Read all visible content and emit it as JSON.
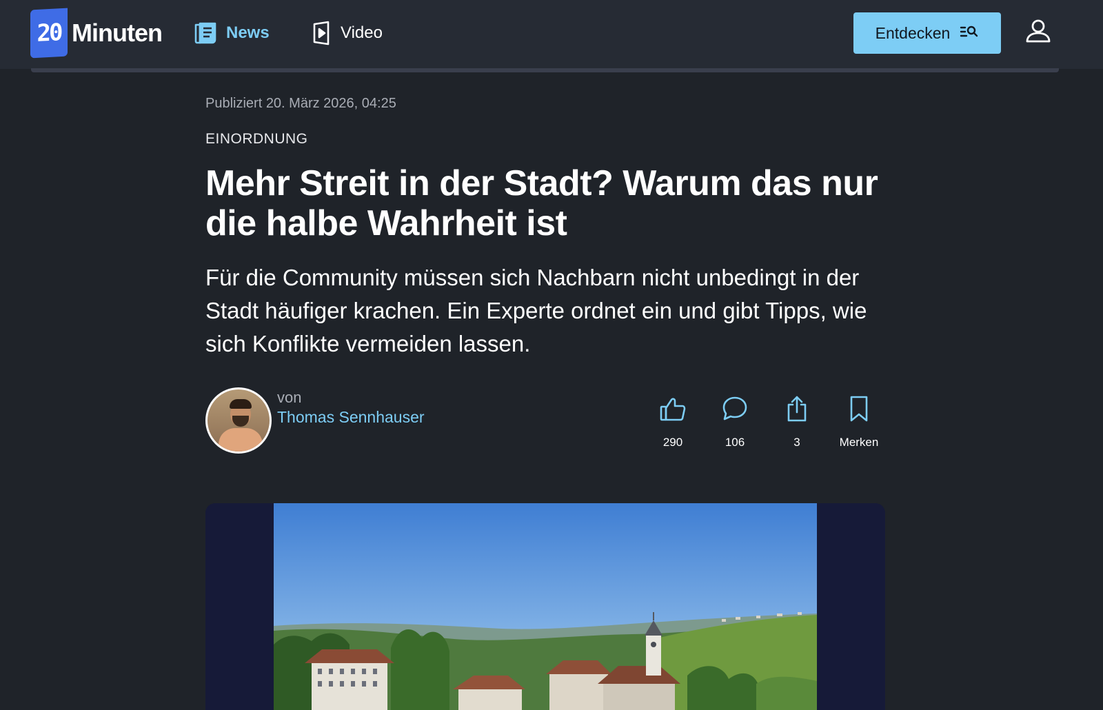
{
  "header": {
    "logo_mark": "20",
    "logo_text": "Minuten",
    "nav": {
      "news": "News",
      "video": "Video"
    },
    "discover_label": "Entdecken"
  },
  "colors": {
    "background": "#1f2329",
    "header_background": "#262b34",
    "accent": "#7dcdf5",
    "logo_blue": "#3f6ce6",
    "hero_background": "#161a38"
  },
  "article": {
    "published": "Publiziert 20. März 2026, 04:25",
    "category": "EINORDNUNG",
    "headline": "Mehr Streit in der Stadt? Warum das nur die halbe Wahrheit ist",
    "lead": "Für die Community müssen sich Nachbarn nicht unbedingt in der Stadt häufiger krachen. Ein Experte ordnet ein und gibt Tipps, wie sich Konflikte vermeiden lassen.",
    "author_prefix": "von",
    "author_name": "Thomas Sennhauser"
  },
  "actions": {
    "likes": "290",
    "comments": "106",
    "shares": "3",
    "save_label": "Merken"
  },
  "icons": {
    "news": "newspaper-icon",
    "video": "play-icon",
    "discover": "search-list-icon",
    "user": "user-icon",
    "like": "thumbs-up-icon",
    "comment": "speech-bubble-icon",
    "share": "share-icon",
    "save": "bookmark-icon"
  }
}
